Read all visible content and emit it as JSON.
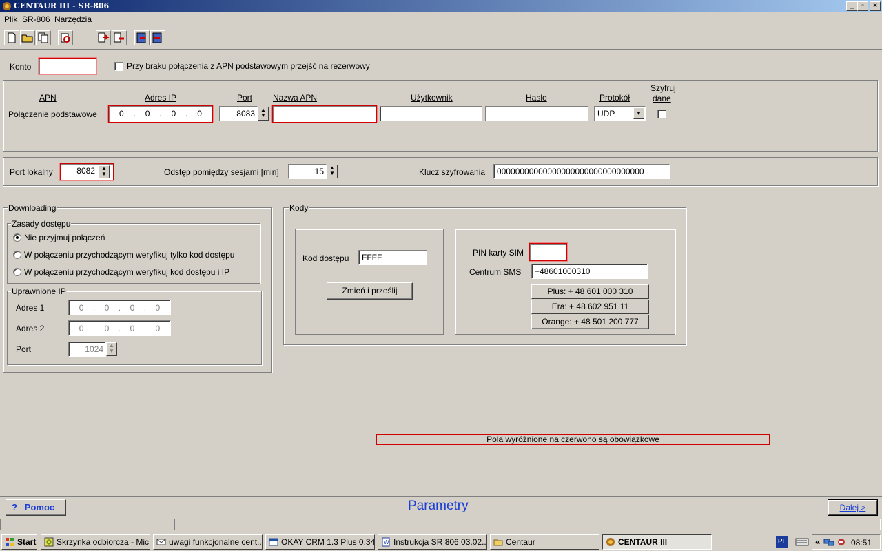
{
  "window": {
    "title": "CENTAUR III -  SR-806",
    "minimize_label": "_",
    "maximize_label": "▫",
    "close_label": "×"
  },
  "menu": [
    "Plik",
    "SR-806",
    "Narzędzia"
  ],
  "toolbar_icons": [
    "new-file-icon",
    "open-folder-icon",
    "copy-pages-icon",
    "print-preview-icon",
    "import-icon",
    "export-icon",
    "upload-device-icon",
    "download-device-icon"
  ],
  "account": {
    "label": "Konto",
    "value": "",
    "fallback_label": "Przy braku połączenia z APN podstawowym przejść na rezerwowy",
    "fallback_checked": false
  },
  "apn": {
    "col_apn": "APN",
    "col_ip": "Adres IP",
    "col_port": "Port",
    "col_name": "Nazwa APN",
    "col_user": "Użytkownik",
    "col_pass": "Hasło",
    "col_proto": "Protokół",
    "col_encrypt_1": "Szyfruj",
    "col_encrypt_2": "dane",
    "row_label": "Połączenie podstawowe",
    "ip": [
      "0",
      "0",
      "0",
      "0"
    ],
    "port": "8083",
    "name": "",
    "user": "",
    "password": "",
    "protocol": "UDP",
    "encrypt": false
  },
  "local": {
    "port_label": "Port lokalny",
    "port": "8082",
    "interval_label": "Odstęp pomiędzy sesjami [min]",
    "interval": "15",
    "key_label": "Klucz szyfrowania",
    "key": "00000000000000000000000000000000"
  },
  "downloading": {
    "title": "Downloading",
    "access_title": "Zasady dostępu",
    "options": [
      "Nie przyjmuj połączeń",
      "W połączeniu przychodzącym weryfikuj tylko kod dostępu",
      "W połączeniu przychodzącym weryfikuj kod dostępu i IP"
    ],
    "selected": 0,
    "ip_title": "Uprawnione IP",
    "addr1_label": "Adres 1",
    "addr1": [
      "0",
      "0",
      "0",
      "0"
    ],
    "addr2_label": "Adres 2",
    "addr2": [
      "0",
      "0",
      "0",
      "0"
    ],
    "port_label": "Port",
    "port": "1024"
  },
  "codes": {
    "title": "Kody",
    "access_code_label": "Kod dostępu",
    "access_code": "FFFF",
    "change_button": "Zmień i prześlij",
    "pin_label": "PIN karty SIM",
    "pin": "",
    "sms_label": "Centrum SMS",
    "sms": "+48601000310",
    "operators": [
      "Plus: + 48 601 000 310",
      "Era: + 48 602 951 11",
      "Orange: + 48 501 200 777"
    ]
  },
  "notice": "Pola wyróżnione na czerwono są obowiązkowe",
  "footer": {
    "help": "?   Pomoc",
    "page_title": "Parametry",
    "next": "Dalej >"
  },
  "colors": {
    "required_border": "#d00000",
    "title_blue": "#0a246a",
    "link_blue": "#1b3ed6"
  },
  "taskbar": {
    "start": "Start",
    "items": [
      "Skrzynka odbiorcza - Mic...",
      "uwagi funkcjonalne cent...",
      "OKAY CRM 1.3 Plus 0.34...",
      "Instrukcja SR 806 03.02....",
      "Centaur",
      "CENTAUR III"
    ],
    "lang": "PL",
    "expand": "«",
    "clock": "08:51"
  }
}
